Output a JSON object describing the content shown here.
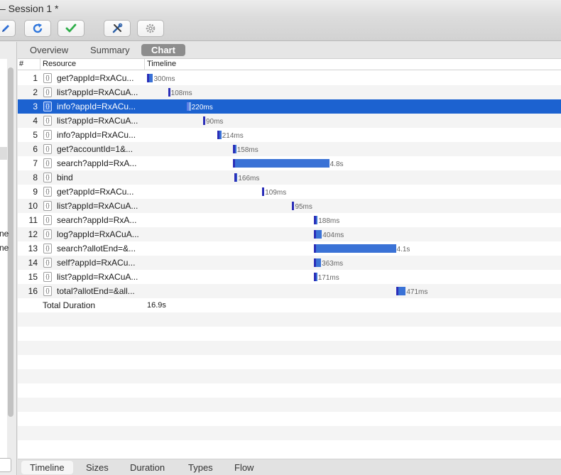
{
  "window": {
    "title": "– Session 1 *"
  },
  "toolbar": {
    "buttons": [
      {
        "icon": "pencil-icon"
      },
      {
        "icon": "refresh-icon"
      },
      {
        "icon": "checkmark-icon"
      },
      {
        "icon": "tools-icon"
      },
      {
        "icon": "gear-icon"
      }
    ]
  },
  "sidebar": {
    "fragments": [
      "ne",
      "ne"
    ]
  },
  "tabs": [
    "Overview",
    "Summary",
    "Chart"
  ],
  "active_tab": "Chart",
  "table": {
    "columns": {
      "num": "#",
      "resource": "Resource",
      "timeline": "Timeline"
    },
    "rows": [
      {
        "num": "1",
        "resource": "get?appId=RxACu...",
        "duration": "300ms",
        "start_s": 0.0,
        "duration_s": 0.3
      },
      {
        "num": "2",
        "resource": "list?appId=RxACuA...",
        "duration": "108ms",
        "start_s": 1.05,
        "duration_s": 0.108
      },
      {
        "num": "3",
        "resource": "info?appId=RxACu...",
        "duration": "220ms",
        "start_s": 1.97,
        "duration_s": 0.22,
        "selected": true
      },
      {
        "num": "4",
        "resource": "list?appId=RxACuA...",
        "duration": "90ms",
        "start_s": 2.8,
        "duration_s": 0.09
      },
      {
        "num": "5",
        "resource": "info?appId=RxACu...",
        "duration": "214ms",
        "start_s": 3.5,
        "duration_s": 0.214
      },
      {
        "num": "6",
        "resource": "get?accountId=1&...",
        "duration": "158ms",
        "start_s": 4.3,
        "duration_s": 0.158
      },
      {
        "num": "7",
        "resource": "search?appId=RxA...",
        "duration": "4.8s",
        "start_s": 4.3,
        "duration_s": 4.8
      },
      {
        "num": "8",
        "resource": "bind",
        "duration": "166ms",
        "start_s": 4.35,
        "duration_s": 0.166
      },
      {
        "num": "9",
        "resource": "get?appId=RxACu...",
        "duration": "109ms",
        "start_s": 5.75,
        "duration_s": 0.109
      },
      {
        "num": "10",
        "resource": "list?appId=RxACuA...",
        "duration": "95ms",
        "start_s": 7.25,
        "duration_s": 0.095
      },
      {
        "num": "11",
        "resource": "search?appId=RxA...",
        "duration": "188ms",
        "start_s": 8.33,
        "duration_s": 0.188
      },
      {
        "num": "12",
        "resource": "log?appId=RxACuA...",
        "duration": "404ms",
        "start_s": 8.33,
        "duration_s": 0.404
      },
      {
        "num": "13",
        "resource": "search?allotEnd=&...",
        "duration": "4.1s",
        "start_s": 8.33,
        "duration_s": 4.1
      },
      {
        "num": "14",
        "resource": "self?appId=RxACu...",
        "duration": "363ms",
        "start_s": 8.33,
        "duration_s": 0.363
      },
      {
        "num": "15",
        "resource": "list?appId=RxACuA...",
        "duration": "171ms",
        "start_s": 8.33,
        "duration_s": 0.171
      },
      {
        "num": "16",
        "resource": "total?allotEnd=&all...",
        "duration": "471ms",
        "start_s": 12.45,
        "duration_s": 0.471
      }
    ],
    "total": {
      "label": "Total Duration",
      "value": "16.9s"
    }
  },
  "bottom_tabs": [
    "Timeline",
    "Sizes",
    "Duration",
    "Types",
    "Flow"
  ],
  "active_bottom_tab": "Timeline",
  "colors": {
    "selection": "#1c62d0",
    "bar_lead": "#2b2eb8",
    "bar_body": "#3a72d6"
  }
}
